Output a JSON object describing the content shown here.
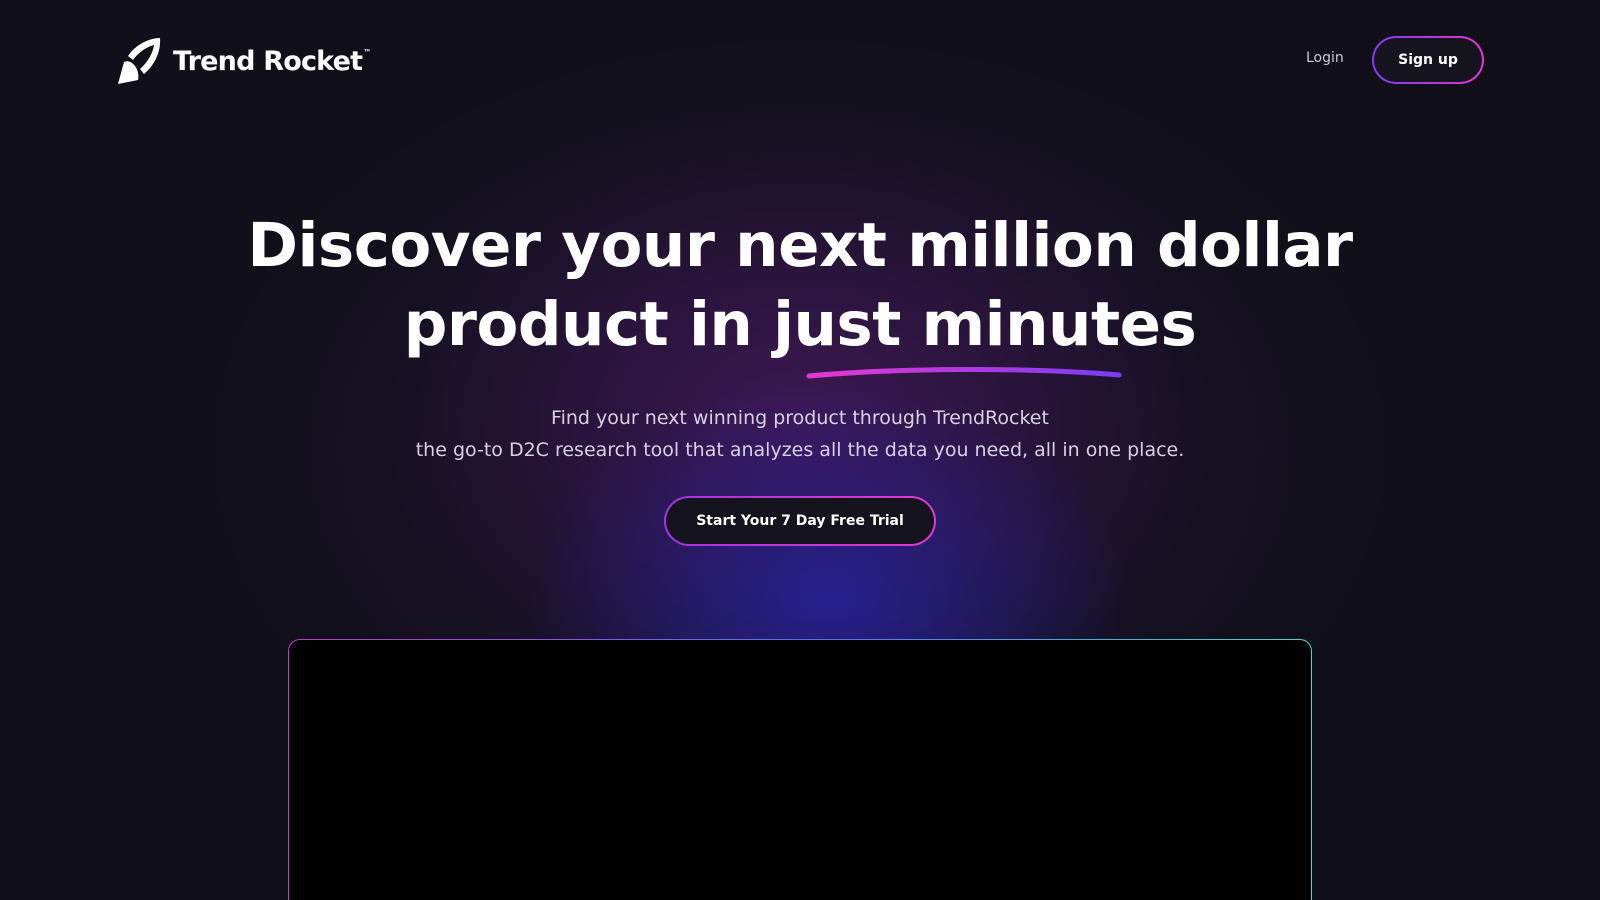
{
  "brand": {
    "name": "Trend Rocket",
    "trademark": "™"
  },
  "nav": {
    "login_label": "Login",
    "signup_label": "Sign up"
  },
  "hero": {
    "title_line1": "Discover your next million dollar",
    "title_line2": "product in just minutes",
    "subtitle_line1": "Find your next winning product through TrendRocket",
    "subtitle_line2": "the go-to D2C research tool that analyzes all the data you need, all in one place.",
    "cta_label": "Start Your 7 Day Free Trial"
  },
  "icons": {
    "logo": "rocket-logo-icon",
    "underline": "highlight-underline"
  },
  "colors": {
    "background": "#11101a",
    "accent_purple": "#7b3df0",
    "accent_pink": "#e23ad0",
    "accent_teal": "#4fd6c9",
    "glow_blue": "#2624aa"
  }
}
